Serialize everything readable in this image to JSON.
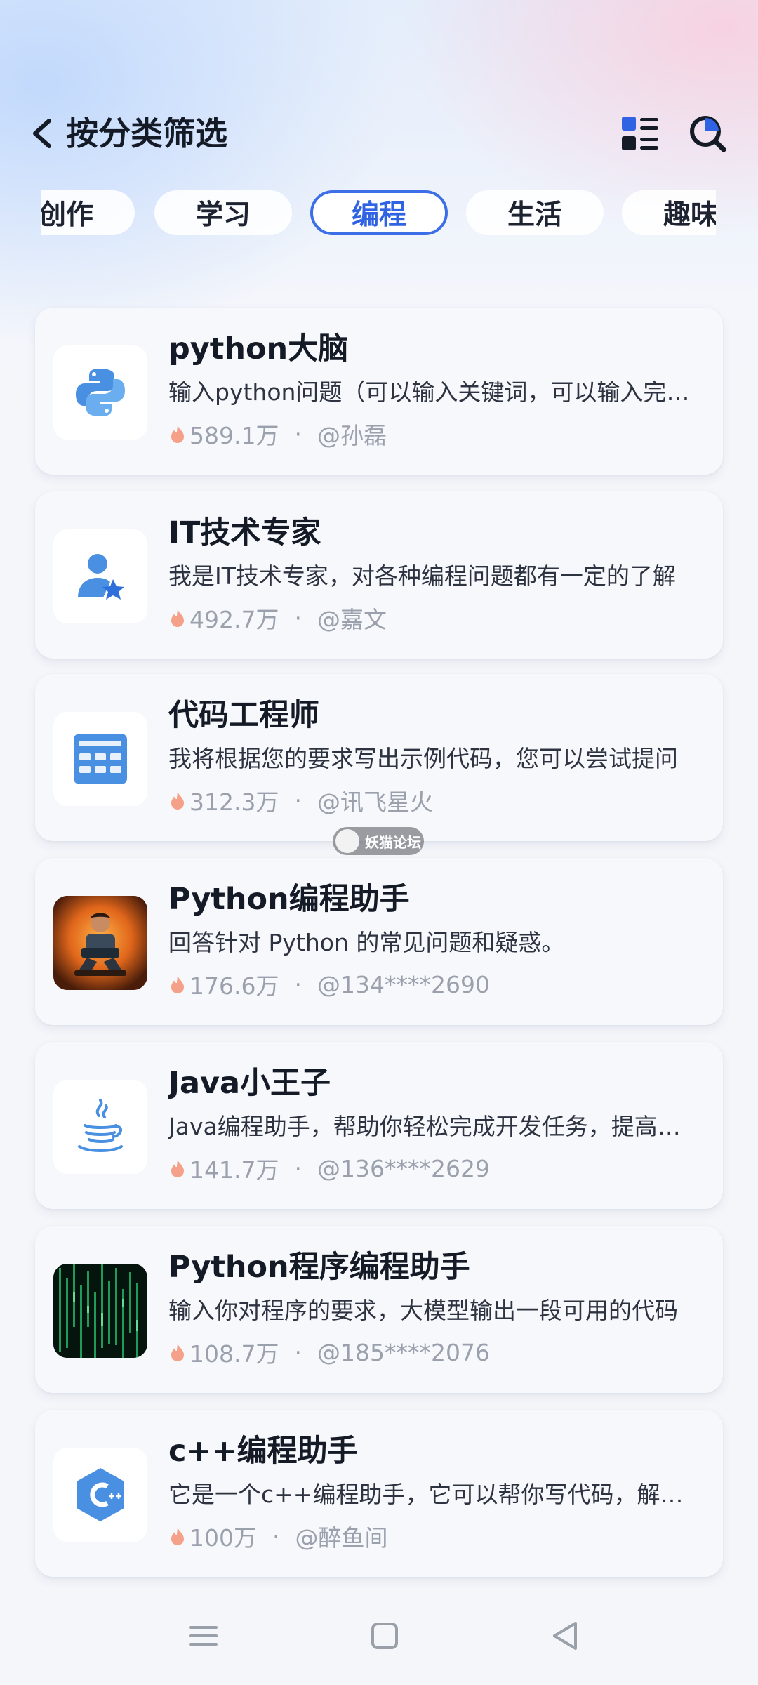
{
  "header": {
    "title": "按分类筛选",
    "back_icon": "chevron-left-icon",
    "grid_icon": "grid-list-icon",
    "search_icon": "search-icon"
  },
  "tabs": [
    {
      "label": "创作",
      "active": false
    },
    {
      "label": "学习",
      "active": false
    },
    {
      "label": "编程",
      "active": true
    },
    {
      "label": "生活",
      "active": false
    },
    {
      "label": "趣味",
      "active": false
    }
  ],
  "items": [
    {
      "title": "python大脑",
      "desc": "输入python问题（可以输入关键词，可以输入完整问题）",
      "hot": "589.1万",
      "author": "@孙磊",
      "icon": "python-icon"
    },
    {
      "title": "IT技术专家",
      "desc": "我是IT技术专家，对各种编程问题都有一定的了解",
      "hot": "492.7万",
      "author": "@嘉文",
      "icon": "user-star-icon"
    },
    {
      "title": "代码工程师",
      "desc": "我将根据您的要求写出示例代码，您可以尝试提问",
      "hot": "312.3万",
      "author": "@讯飞星火",
      "icon": "keyboard-icon"
    },
    {
      "title": "Python编程助手",
      "desc": "回答针对 Python 的常见问题和疑惑。",
      "hot": "176.6万",
      "author": "@134****2690",
      "icon": "programmer-avatar-icon"
    },
    {
      "title": "Java小王子",
      "desc": "Java编程助手，帮助你轻松完成开发任务，提高效率",
      "hot": "141.7万",
      "author": "@136****2629",
      "icon": "java-icon"
    },
    {
      "title": "Python程序编程助手",
      "desc": "输入你对程序的要求，大模型输出一段可用的代码",
      "hot": "108.7万",
      "author": "@185****2076",
      "icon": "code-matrix-icon"
    },
    {
      "title": "c++编程助手",
      "desc": "它是一个c++编程助手，它可以帮你写代码，解答问题",
      "hot": "100万",
      "author": "@醉鱼间",
      "icon": "cpp-icon"
    }
  ],
  "watermark": {
    "text": "妖猫论坛"
  },
  "navbar": {
    "menu_icon": "menu-icon",
    "home_icon": "square-home-icon",
    "back_icon": "triangle-back-icon"
  },
  "colors": {
    "accent": "#3c6fe7",
    "title_text": "#141a26",
    "meta_text": "#9aa1ad",
    "flame": "#f5a089"
  }
}
